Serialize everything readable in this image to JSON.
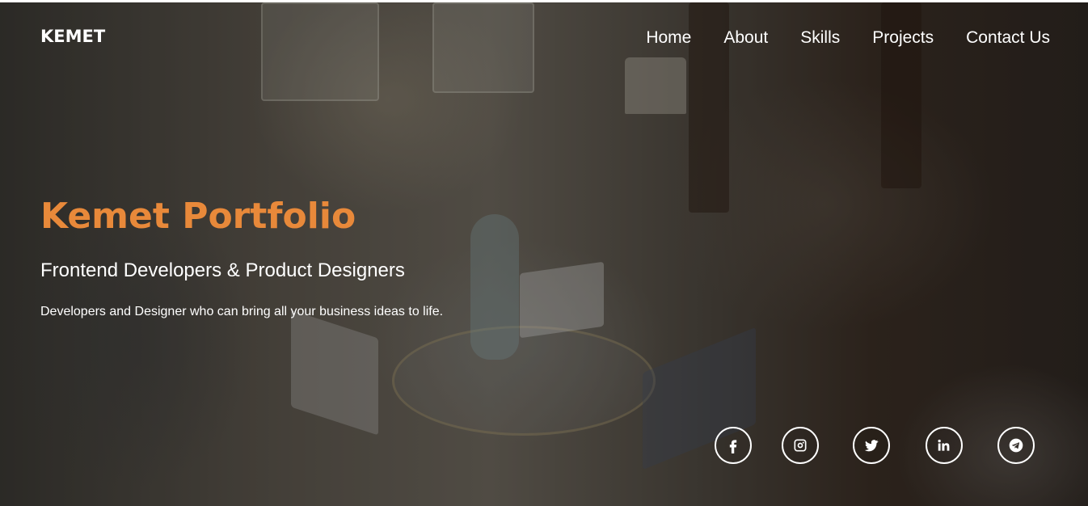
{
  "brand": {
    "name": "KEMET"
  },
  "nav": {
    "items": [
      {
        "label": "Home"
      },
      {
        "label": "About"
      },
      {
        "label": "Skills"
      },
      {
        "label": "Projects"
      },
      {
        "label": "Contact Us"
      }
    ]
  },
  "hero": {
    "title": "Kemet Portfolio",
    "subtitle": "Frontend Developers & Product Designers",
    "description": "Developers and Designer who can bring all your business ideas to life.",
    "accent_color": "#e8893a",
    "text_color": "#ffffff"
  },
  "socials": [
    {
      "icon": "facebook-icon"
    },
    {
      "icon": "instagram-icon"
    },
    {
      "icon": "twitter-icon"
    },
    {
      "icon": "linkedin-icon"
    },
    {
      "icon": "telegram-icon"
    }
  ]
}
